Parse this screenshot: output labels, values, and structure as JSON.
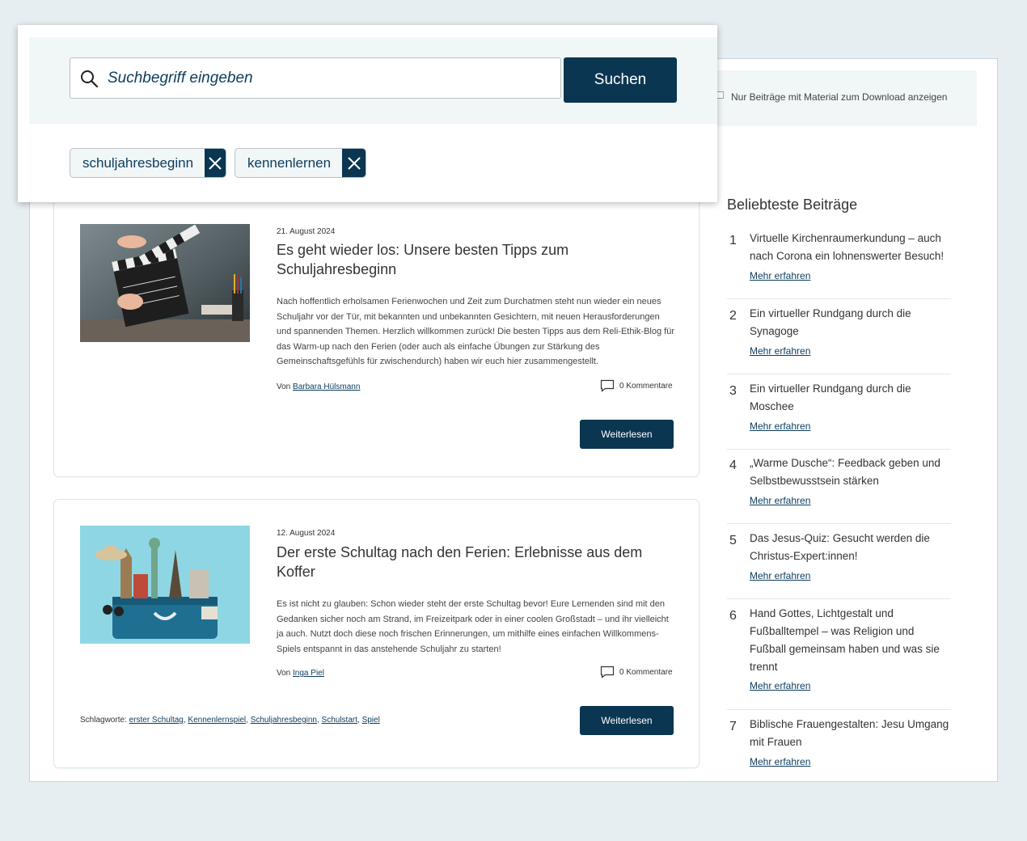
{
  "search": {
    "placeholder": "Suchbegriff eingeben",
    "button_label": "Suchen",
    "chips": [
      "schuljahresbeginn",
      "kennenlernen"
    ]
  },
  "filter": {
    "download_only_label": "Nur Beiträge mit Material zum Download anzeigen"
  },
  "posts": [
    {
      "date": "21. August 2024",
      "title": "Es geht wieder los: Unsere besten Tipps zum Schuljahresbeginn",
      "excerpt": "Nach hoffentlich erholsamen Ferienwochen und Zeit zum Durchatmen steht nun wieder ein neues Schuljahr vor der Tür, mit bekannten und unbekannten Gesichtern, mit neuen Herausforderungen und spannenden Themen. Herzlich willkommen zurück! Die besten Tipps aus dem Reli-Ethik-Blog für das Warm-up nach den Ferien (oder auch als einfache Übungen zur Stärkung des Gemeinschaftsgefühls für zwischendurch) haben wir euch hier zusammengestellt.",
      "author_prefix": "Von",
      "author": "Barbara Hülsmann",
      "comments": "0 Kommentare",
      "read_more": "Weiterlesen"
    },
    {
      "date": "12. August 2024",
      "title": "Der erste Schultag nach den Ferien: Erlebnisse aus dem Koffer",
      "excerpt": "Es ist nicht zu glauben: Schon wieder steht der erste Schultag bevor! Eure Lernenden sind mit den Gedanken sicher noch am Strand, im Freizeitpark oder in einer coolen Großstadt – und ihr vielleicht ja auch. Nutzt doch diese noch frischen Erinnerungen, um mithilfe eines einfachen Willkommens-Spiels entspannt in das anstehende Schuljahr zu starten!",
      "author_prefix": "Von",
      "author": "Inga Piel",
      "comments": "0 Kommentare",
      "read_more": "Weiterlesen",
      "tags_label": "Schlagworte:",
      "tags": [
        "erster Schultag",
        "Kennenlernspiel",
        "Schuljahresbeginn",
        "Schulstart",
        "Spiel"
      ]
    }
  ],
  "sidebar": {
    "heading": "Beliebteste Beiträge",
    "more_label": "Mehr erfahren",
    "items": [
      {
        "num": "1",
        "title": "Virtuelle Kirchenraumerkundung – auch nach Corona ein lohnenswerter Besuch!"
      },
      {
        "num": "2",
        "title": "Ein virtueller Rundgang durch die Synagoge"
      },
      {
        "num": "3",
        "title": "Ein virtueller Rundgang durch die Moschee"
      },
      {
        "num": "4",
        "title": "„Warme Dusche“: Feedback geben und Selbstbewusstsein stärken"
      },
      {
        "num": "5",
        "title": "Das Jesus-Quiz: Gesucht werden die Christus-Expert:innen!"
      },
      {
        "num": "6",
        "title": "Hand Gottes, Lichtgestalt und Fußballtempel – was Religion und Fußball gemeinsam haben und was sie trennt"
      },
      {
        "num": "7",
        "title": "Biblische Frauengestalten: Jesu Umgang mit Frauen"
      }
    ]
  },
  "colors": {
    "primary": "#0a3651",
    "panel": "#f1f6f7",
    "page_bg": "#e6eef1"
  }
}
